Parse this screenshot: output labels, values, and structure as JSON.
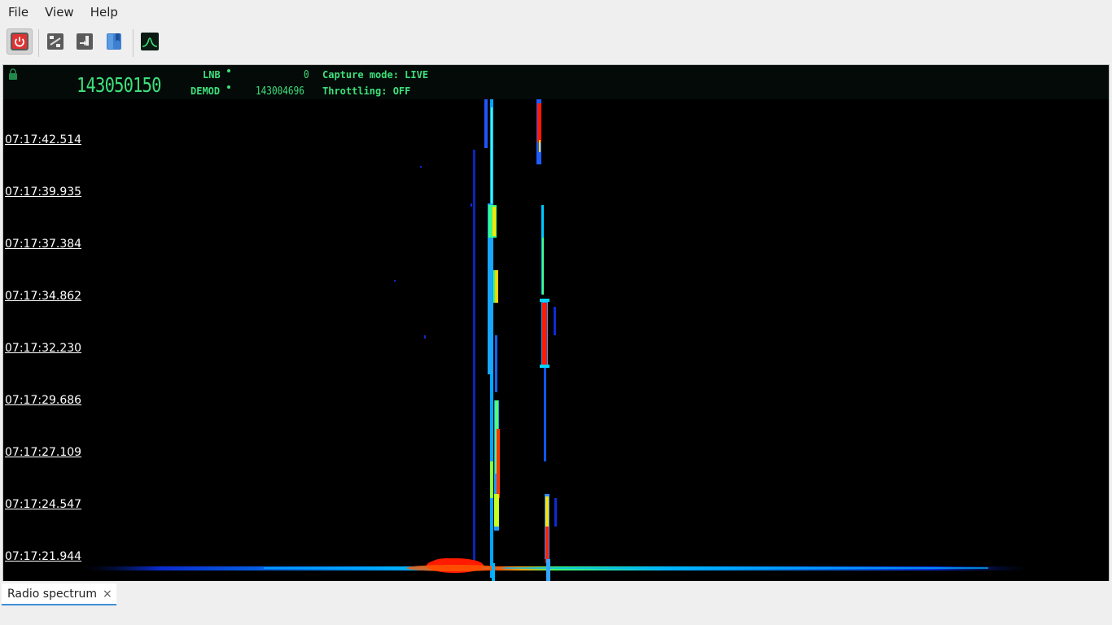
{
  "menu": {
    "file": "File",
    "view": "View",
    "help": "Help"
  },
  "toolbar": {
    "buttons": [
      "power-button",
      "settings-button",
      "record-button",
      "bookmark-button",
      "spectrum-button"
    ]
  },
  "freq_display": {
    "main_frequency": "143050150",
    "lnb_label": "LNB",
    "lnb_value": "0",
    "demod_label": "DEMOD",
    "demod_value": "143004696",
    "capture_mode": "Capture mode: LIVE",
    "throttling": "Throttling: OFF",
    "color": "#3ee07a"
  },
  "waterfall": {
    "timestamps": [
      "07:17:42.514",
      "07:17:39.935",
      "07:17:37.384",
      "07:17:34.862",
      "07:17:32.230",
      "07:17:29.686",
      "07:17:27.109",
      "07:17:24.547",
      "07:17:21.944"
    ]
  },
  "tabs": [
    {
      "label": "Radio spectrum",
      "close": "×"
    }
  ]
}
